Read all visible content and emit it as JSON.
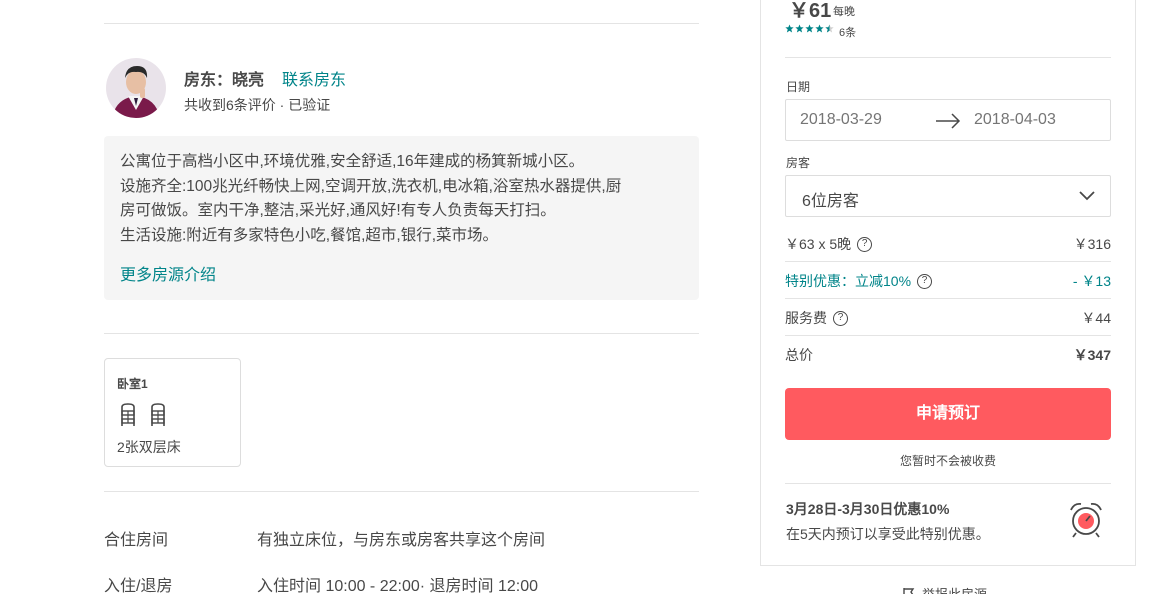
{
  "host": {
    "label": "房东：",
    "name": "晓亮",
    "contact_label": "联系房东",
    "meta": "共收到6条评价 · 已验证"
  },
  "description": {
    "lines": [
      "公寓位于高档小区中,环境优雅,安全舒适,16年建成的杨箕新城小区。",
      "设施齐全:100兆光纤畅快上网,空调开放,洗衣机,电冰箱,浴室热水器提供,厨",
      "房可做饭。室内干净,整洁,采光好,通风好!有专人负责每天打扫。",
      "生活设施:附近有多家特色小吃,餐馆,超市,银行,菜市场。"
    ],
    "more_label": "更多房源介绍"
  },
  "room": {
    "title": "卧室1",
    "bed_icon": "bunk-bed-icon",
    "bed_type": "2张双层床"
  },
  "rules": [
    {
      "label": "合住房间",
      "value": "有独立床位，与房东或房客共享这个房间"
    },
    {
      "label": "入住/退房",
      "value": "入住时间 10:00  -  22:00· 退房时间 12:00"
    }
  ],
  "booking": {
    "price": "￥61",
    "price_unit": "每晚",
    "rating": 4.5,
    "reviews": "6条",
    "dates_label": "日期",
    "check_in": "2018-03-29",
    "check_out": "2018-04-03",
    "guests_label": "房客",
    "guests_value": "6位房客",
    "fees": {
      "nights_label": "￥63 x 5晚",
      "nights_amount": "￥316",
      "discount_label": "特别优惠：立减10%",
      "discount_amount": "- ￥13",
      "service_label": "服务费",
      "service_amount": "￥44",
      "total_label": "总价",
      "total_amount": "￥347"
    },
    "book_label": "申请预订",
    "no_charge": "您暂时不会被收费",
    "promo_title": "3月28日-3月30日优惠10%",
    "promo_text": "在5天内预订以享受此特别优惠。",
    "report_label": "举报此房源"
  },
  "colors": {
    "accent": "#008489",
    "primary_button": "#ff5a5f",
    "text": "#484848"
  }
}
